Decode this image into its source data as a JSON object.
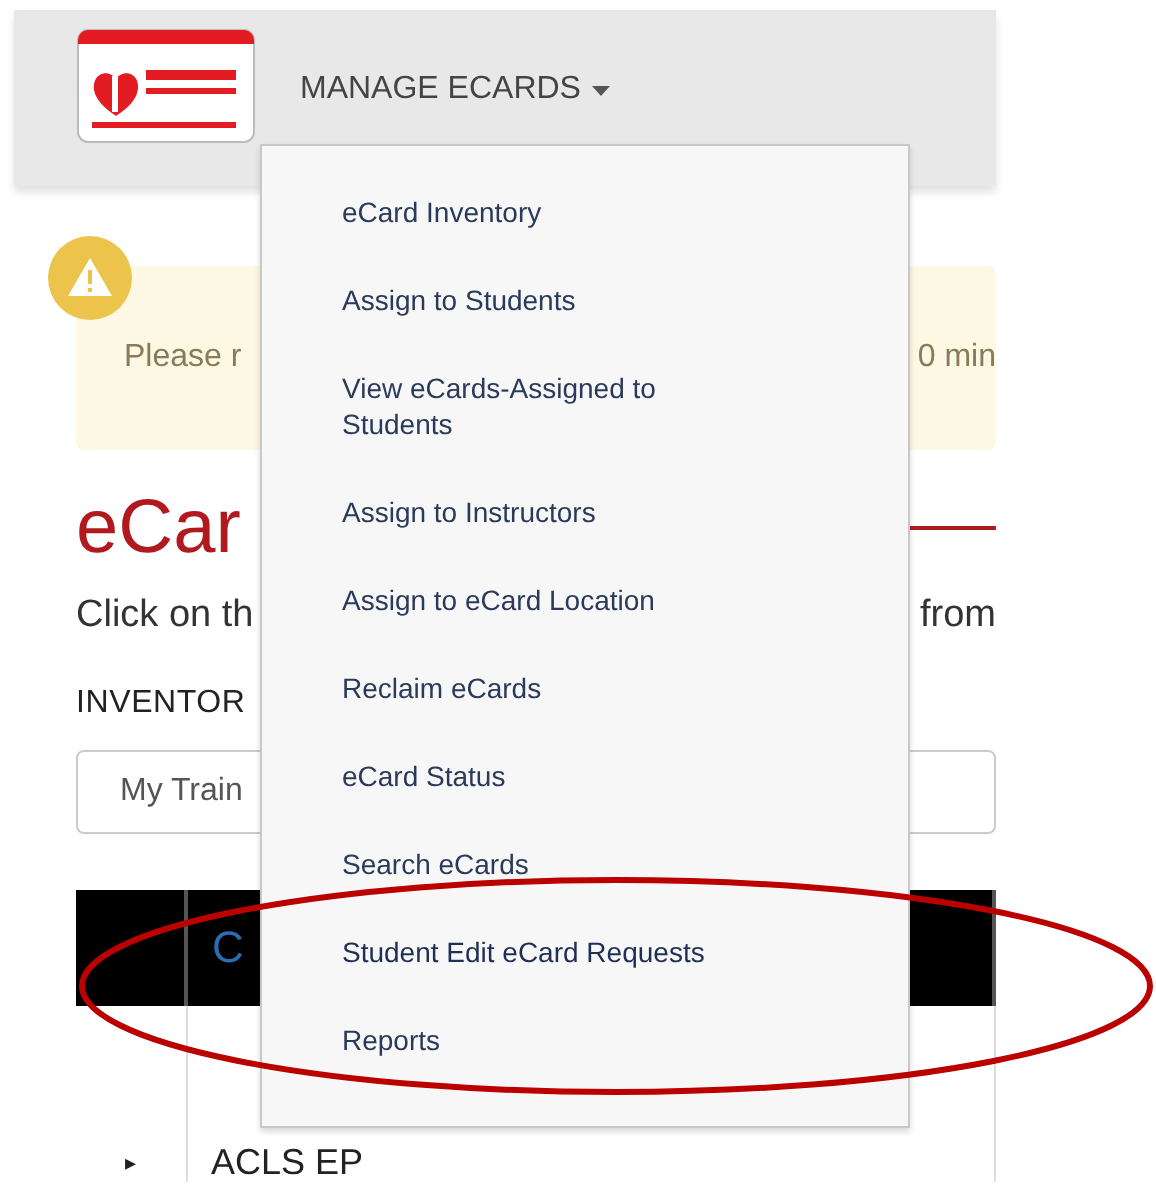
{
  "header": {
    "menu": {
      "label": "MANAGE ECARDS",
      "expanded": true,
      "items": [
        {
          "label": "eCard Inventory"
        },
        {
          "label": "Assign to Students"
        },
        {
          "label": "View eCards-Assigned to Students"
        },
        {
          "label": "Assign to Instructors"
        },
        {
          "label": "Assign to eCard Location"
        },
        {
          "label": "Reclaim eCards"
        },
        {
          "label": "eCard Status"
        },
        {
          "label": "Search eCards"
        },
        {
          "label": "Student Edit eCard Requests",
          "highlighted": true
        },
        {
          "label": "Reports"
        }
      ]
    }
  },
  "alert": {
    "text_left": "Please r",
    "text_right": "0 min"
  },
  "page_title": "eCar",
  "instruction": {
    "text_left": "Click on th",
    "text_right": "from"
  },
  "inventory_label": "INVENTOR",
  "inventory_select": {
    "value": "My Train"
  },
  "table": {
    "columns": [
      {},
      {
        "label": "C"
      }
    ],
    "rows": [
      {
        "expander": "▸",
        "column_2": "ACLS EP"
      }
    ]
  }
}
